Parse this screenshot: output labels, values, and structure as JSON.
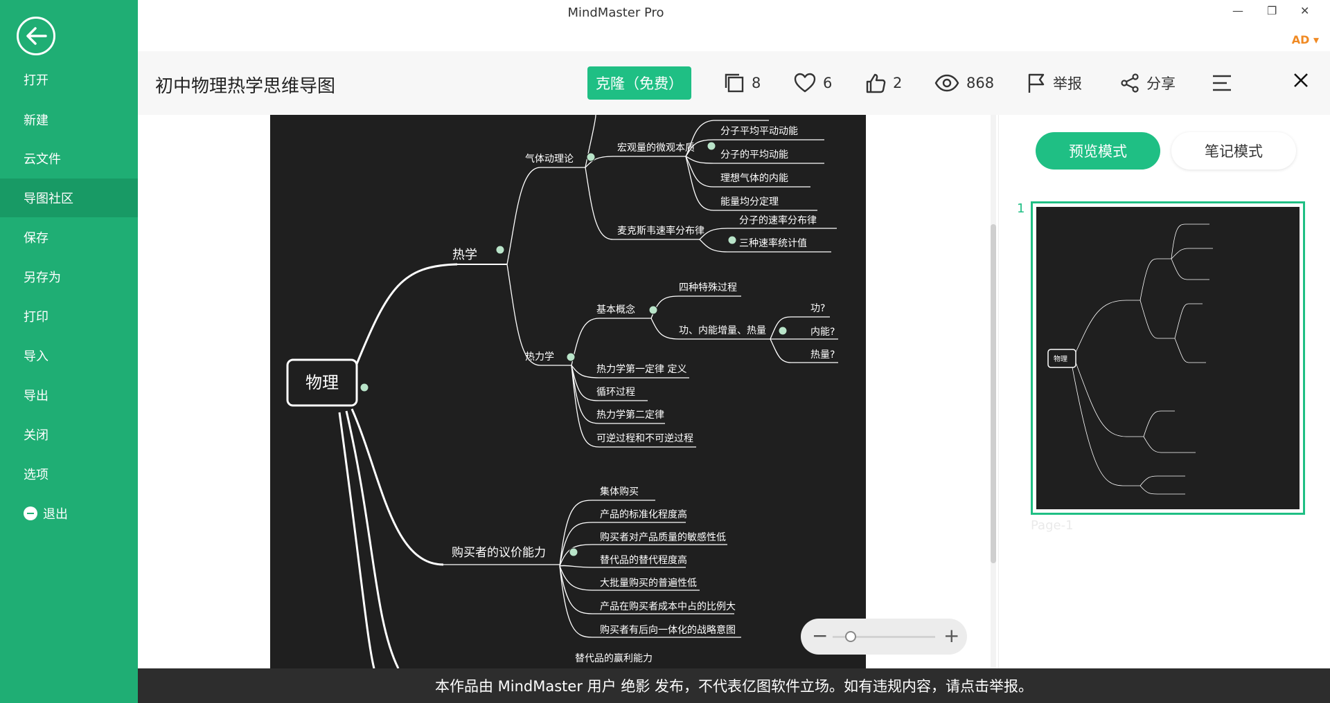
{
  "app": {
    "title": "MindMaster Pro",
    "user": "AD ▾"
  },
  "sidebar": {
    "items": [
      {
        "label": "打开"
      },
      {
        "label": "新建"
      },
      {
        "label": "云文件"
      },
      {
        "label": "导图社区"
      },
      {
        "label": "保存"
      },
      {
        "label": "另存为"
      },
      {
        "label": "打印"
      },
      {
        "label": "导入"
      },
      {
        "label": "导出"
      },
      {
        "label": "关闭"
      },
      {
        "label": "选项"
      },
      {
        "label": "退出"
      }
    ],
    "active": "导图社区"
  },
  "doc": {
    "title": "初中物理热学思维导图",
    "clone_label": "克隆（免费）",
    "stats": {
      "copies": "8",
      "favorites": "6",
      "likes": "2",
      "views": "868",
      "report": "举报",
      "share": "分享"
    }
  },
  "mindmap": {
    "root": "物理",
    "nodes": {
      "heat": "热学",
      "gas_theory": "气体动理论",
      "macro_micro": "宏观量的微观本质",
      "avg_trans_ke": "分子平均平动动能",
      "avg_ke": "分子的平均动能",
      "ideal_gas_ie": "理想气体的内能",
      "equipartition": "能量均分定理",
      "maxwell": "麦克斯韦速率分布律",
      "speed_dist": "分子的速率分布律",
      "three_speeds": "三种速率统计值",
      "thermo": "热力学",
      "basics": "基本概念",
      "four_processes": "四种特殊过程",
      "work_energy_heat": "功、内能增量、热量",
      "work_q": "功?",
      "ie_q": "内能?",
      "heat_q": "热量?",
      "first_law": "热力学第一定律 定义",
      "cycle": "循环过程",
      "second_law": "热力学第二定律",
      "reversible": "可逆过程和不可逆过程",
      "buyer_power": "购买者的议价能力",
      "group_buy": "集体购买",
      "standardization": "产品的标准化程度高",
      "quality_sensitivity": "购买者对产品质量的敏感性低",
      "substitute_degree": "替代品的替代程度高",
      "bulk_buy": "大批量购买的普遍性低",
      "cost_share": "产品在购买者成本中占的比例大",
      "backward_integration": "购买者有后向一体化的战略意图",
      "substitute_profit": "替代品的赢利能力"
    }
  },
  "right_panel": {
    "preview_label": "预览模式",
    "notes_label": "笔记模式",
    "page_number": "1",
    "page_label": "Page-1"
  },
  "footer": {
    "text": "本作品由 MindMaster 用户 绝影 发布，不代表亿图软件立场。如有违规内容，请点击举报。"
  },
  "colors": {
    "brand": "#1fae74",
    "accent": "#1fbf84",
    "canvas": "#1f1f1f",
    "user": "#f08a24"
  }
}
